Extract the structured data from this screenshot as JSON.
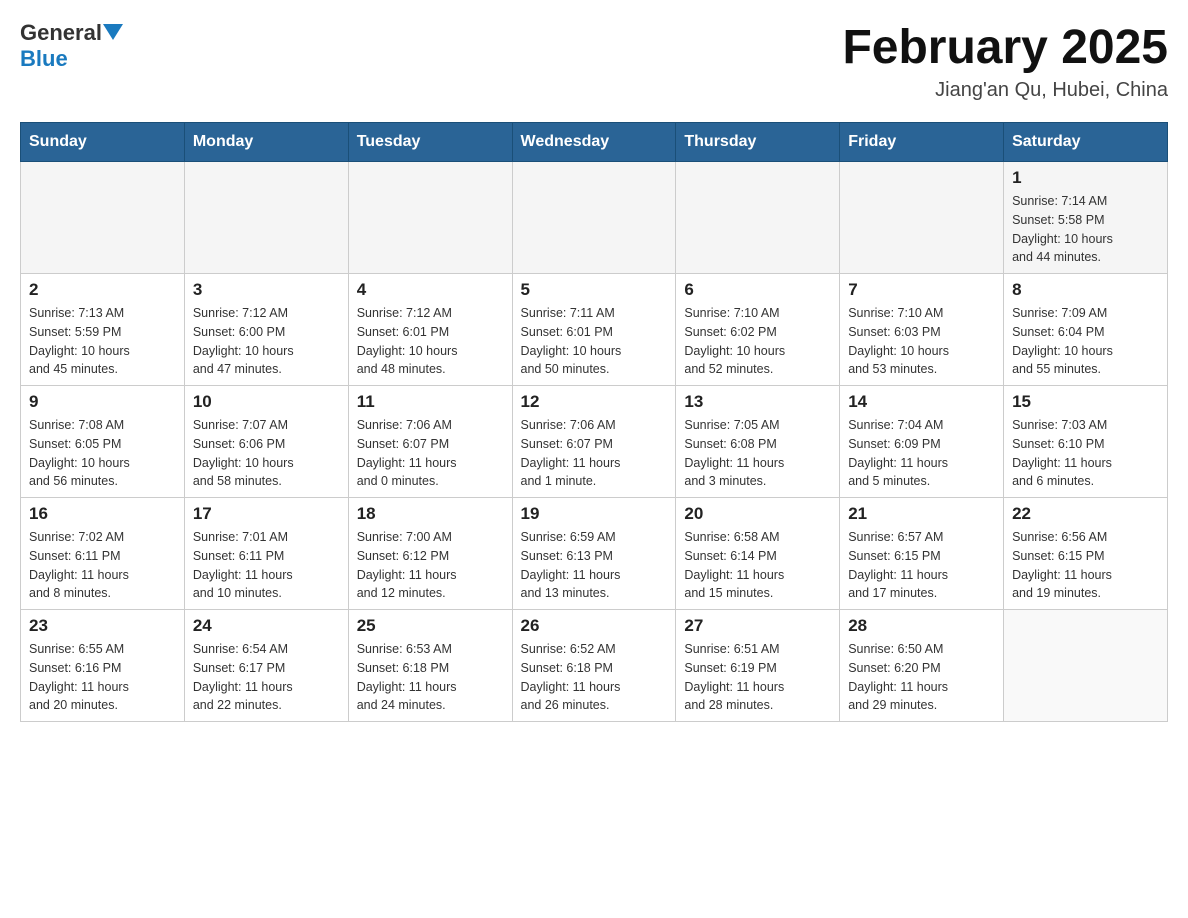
{
  "header": {
    "logo_general": "General",
    "logo_blue": "Blue",
    "month_title": "February 2025",
    "location": "Jiang'an Qu, Hubei, China"
  },
  "calendar": {
    "days_of_week": [
      "Sunday",
      "Monday",
      "Tuesday",
      "Wednesday",
      "Thursday",
      "Friday",
      "Saturday"
    ],
    "weeks": [
      [
        {
          "day": "",
          "info": ""
        },
        {
          "day": "",
          "info": ""
        },
        {
          "day": "",
          "info": ""
        },
        {
          "day": "",
          "info": ""
        },
        {
          "day": "",
          "info": ""
        },
        {
          "day": "",
          "info": ""
        },
        {
          "day": "1",
          "info": "Sunrise: 7:14 AM\nSunset: 5:58 PM\nDaylight: 10 hours\nand 44 minutes."
        }
      ],
      [
        {
          "day": "2",
          "info": "Sunrise: 7:13 AM\nSunset: 5:59 PM\nDaylight: 10 hours\nand 45 minutes."
        },
        {
          "day": "3",
          "info": "Sunrise: 7:12 AM\nSunset: 6:00 PM\nDaylight: 10 hours\nand 47 minutes."
        },
        {
          "day": "4",
          "info": "Sunrise: 7:12 AM\nSunset: 6:01 PM\nDaylight: 10 hours\nand 48 minutes."
        },
        {
          "day": "5",
          "info": "Sunrise: 7:11 AM\nSunset: 6:01 PM\nDaylight: 10 hours\nand 50 minutes."
        },
        {
          "day": "6",
          "info": "Sunrise: 7:10 AM\nSunset: 6:02 PM\nDaylight: 10 hours\nand 52 minutes."
        },
        {
          "day": "7",
          "info": "Sunrise: 7:10 AM\nSunset: 6:03 PM\nDaylight: 10 hours\nand 53 minutes."
        },
        {
          "day": "8",
          "info": "Sunrise: 7:09 AM\nSunset: 6:04 PM\nDaylight: 10 hours\nand 55 minutes."
        }
      ],
      [
        {
          "day": "9",
          "info": "Sunrise: 7:08 AM\nSunset: 6:05 PM\nDaylight: 10 hours\nand 56 minutes."
        },
        {
          "day": "10",
          "info": "Sunrise: 7:07 AM\nSunset: 6:06 PM\nDaylight: 10 hours\nand 58 minutes."
        },
        {
          "day": "11",
          "info": "Sunrise: 7:06 AM\nSunset: 6:07 PM\nDaylight: 11 hours\nand 0 minutes."
        },
        {
          "day": "12",
          "info": "Sunrise: 7:06 AM\nSunset: 6:07 PM\nDaylight: 11 hours\nand 1 minute."
        },
        {
          "day": "13",
          "info": "Sunrise: 7:05 AM\nSunset: 6:08 PM\nDaylight: 11 hours\nand 3 minutes."
        },
        {
          "day": "14",
          "info": "Sunrise: 7:04 AM\nSunset: 6:09 PM\nDaylight: 11 hours\nand 5 minutes."
        },
        {
          "day": "15",
          "info": "Sunrise: 7:03 AM\nSunset: 6:10 PM\nDaylight: 11 hours\nand 6 minutes."
        }
      ],
      [
        {
          "day": "16",
          "info": "Sunrise: 7:02 AM\nSunset: 6:11 PM\nDaylight: 11 hours\nand 8 minutes."
        },
        {
          "day": "17",
          "info": "Sunrise: 7:01 AM\nSunset: 6:11 PM\nDaylight: 11 hours\nand 10 minutes."
        },
        {
          "day": "18",
          "info": "Sunrise: 7:00 AM\nSunset: 6:12 PM\nDaylight: 11 hours\nand 12 minutes."
        },
        {
          "day": "19",
          "info": "Sunrise: 6:59 AM\nSunset: 6:13 PM\nDaylight: 11 hours\nand 13 minutes."
        },
        {
          "day": "20",
          "info": "Sunrise: 6:58 AM\nSunset: 6:14 PM\nDaylight: 11 hours\nand 15 minutes."
        },
        {
          "day": "21",
          "info": "Sunrise: 6:57 AM\nSunset: 6:15 PM\nDaylight: 11 hours\nand 17 minutes."
        },
        {
          "day": "22",
          "info": "Sunrise: 6:56 AM\nSunset: 6:15 PM\nDaylight: 11 hours\nand 19 minutes."
        }
      ],
      [
        {
          "day": "23",
          "info": "Sunrise: 6:55 AM\nSunset: 6:16 PM\nDaylight: 11 hours\nand 20 minutes."
        },
        {
          "day": "24",
          "info": "Sunrise: 6:54 AM\nSunset: 6:17 PM\nDaylight: 11 hours\nand 22 minutes."
        },
        {
          "day": "25",
          "info": "Sunrise: 6:53 AM\nSunset: 6:18 PM\nDaylight: 11 hours\nand 24 minutes."
        },
        {
          "day": "26",
          "info": "Sunrise: 6:52 AM\nSunset: 6:18 PM\nDaylight: 11 hours\nand 26 minutes."
        },
        {
          "day": "27",
          "info": "Sunrise: 6:51 AM\nSunset: 6:19 PM\nDaylight: 11 hours\nand 28 minutes."
        },
        {
          "day": "28",
          "info": "Sunrise: 6:50 AM\nSunset: 6:20 PM\nDaylight: 11 hours\nand 29 minutes."
        },
        {
          "day": "",
          "info": ""
        }
      ]
    ]
  }
}
